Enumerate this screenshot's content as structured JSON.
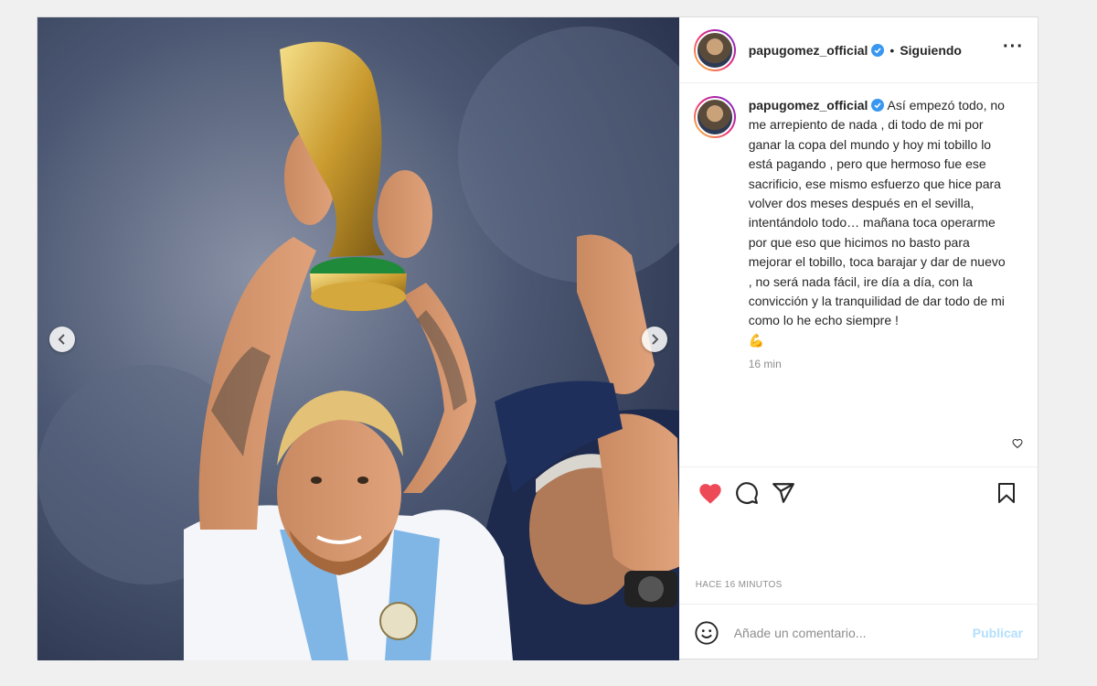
{
  "header": {
    "username": "papugomez_official",
    "separator": "•",
    "follow_label": "Siguiendo",
    "more_label": "···"
  },
  "caption": {
    "username": "papugomez_official",
    "text": "Así empezó todo, no me arrepiento de nada , di todo de mi por ganar la copa del mundo y hoy mi tobillo lo está pagando , pero que hermoso fue ese sacrificio, ese mismo esfuerzo que hice para volver dos meses después en el sevilla, intentándolo todo… mañana toca operarme por que eso que hicimos no basto para mejorar el tobillo, toca barajar y dar de nuevo , no será nada fácil, ire día a día, con la convicción y la tranquilidad de dar todo de mi como lo he echo siempre !",
    "emoji": "💪",
    "time": "16 min"
  },
  "posted_time": "HACE 16 MINUTOS",
  "comment": {
    "placeholder": "Añade un comentario...",
    "publish_label": "Publicar"
  },
  "colors": {
    "like_red": "#ed4956",
    "verified_blue": "#3897f0",
    "publish_blue": "#b2dffc",
    "muted_gray": "#8e8e8e"
  },
  "icons": [
    "chevron-left-icon",
    "chevron-right-icon",
    "verified-icon",
    "heart-icon",
    "comment-icon",
    "share-icon",
    "bookmark-icon",
    "emoji-icon"
  ]
}
